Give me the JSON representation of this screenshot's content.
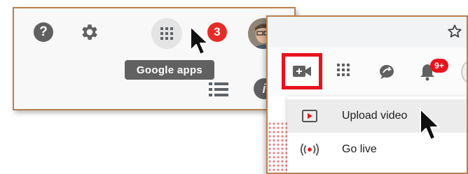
{
  "left_panel": {
    "help_glyph": "?",
    "notification_count": "3",
    "tooltip": "Google apps",
    "info_glyph": "i",
    "icons": [
      "help-icon",
      "gear-icon",
      "apps-grid-icon",
      "avatar",
      "list-icon",
      "info-icon",
      "mouse-cursor-icon"
    ]
  },
  "right_panel": {
    "icons": [
      "star-icon",
      "video-camera-plus-icon",
      "apps-grid-icon",
      "share-icon",
      "bell-icon",
      "avatar"
    ],
    "notification_badge": "9+",
    "menu": [
      {
        "label": "Upload video",
        "icon": "upload-video-icon"
      },
      {
        "label": "Go live",
        "icon": "go-live-icon"
      }
    ]
  },
  "colors": {
    "highlight": "#e8131d",
    "badge": "#e52d27",
    "frame_border": "#b9804f",
    "tooltip_bg": "#616161"
  }
}
